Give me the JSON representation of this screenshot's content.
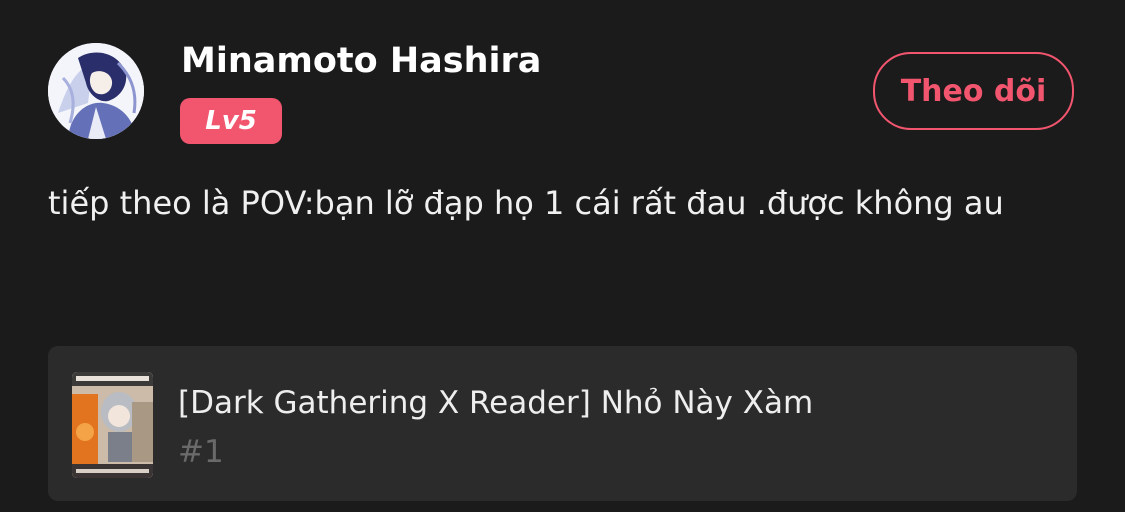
{
  "user": {
    "name": "Minamoto Hashira",
    "level": "Lv5",
    "avatar_icon": "anime-character-avatar"
  },
  "follow": {
    "label": "Theo dõi"
  },
  "post": {
    "text": "tiếp theo là POV:bạn lỡ đạp họ 1 cái rất đau .được không au"
  },
  "story": {
    "title": "[Dark Gathering X Reader] Nhỏ Này Xàm",
    "chapter": "#1",
    "cover_icon": "story-cover-image"
  },
  "colors": {
    "background": "#1c1b1c",
    "card": "#2c2b2c",
    "accent": "#f2566f",
    "muted_text": "#6b6a6b"
  }
}
